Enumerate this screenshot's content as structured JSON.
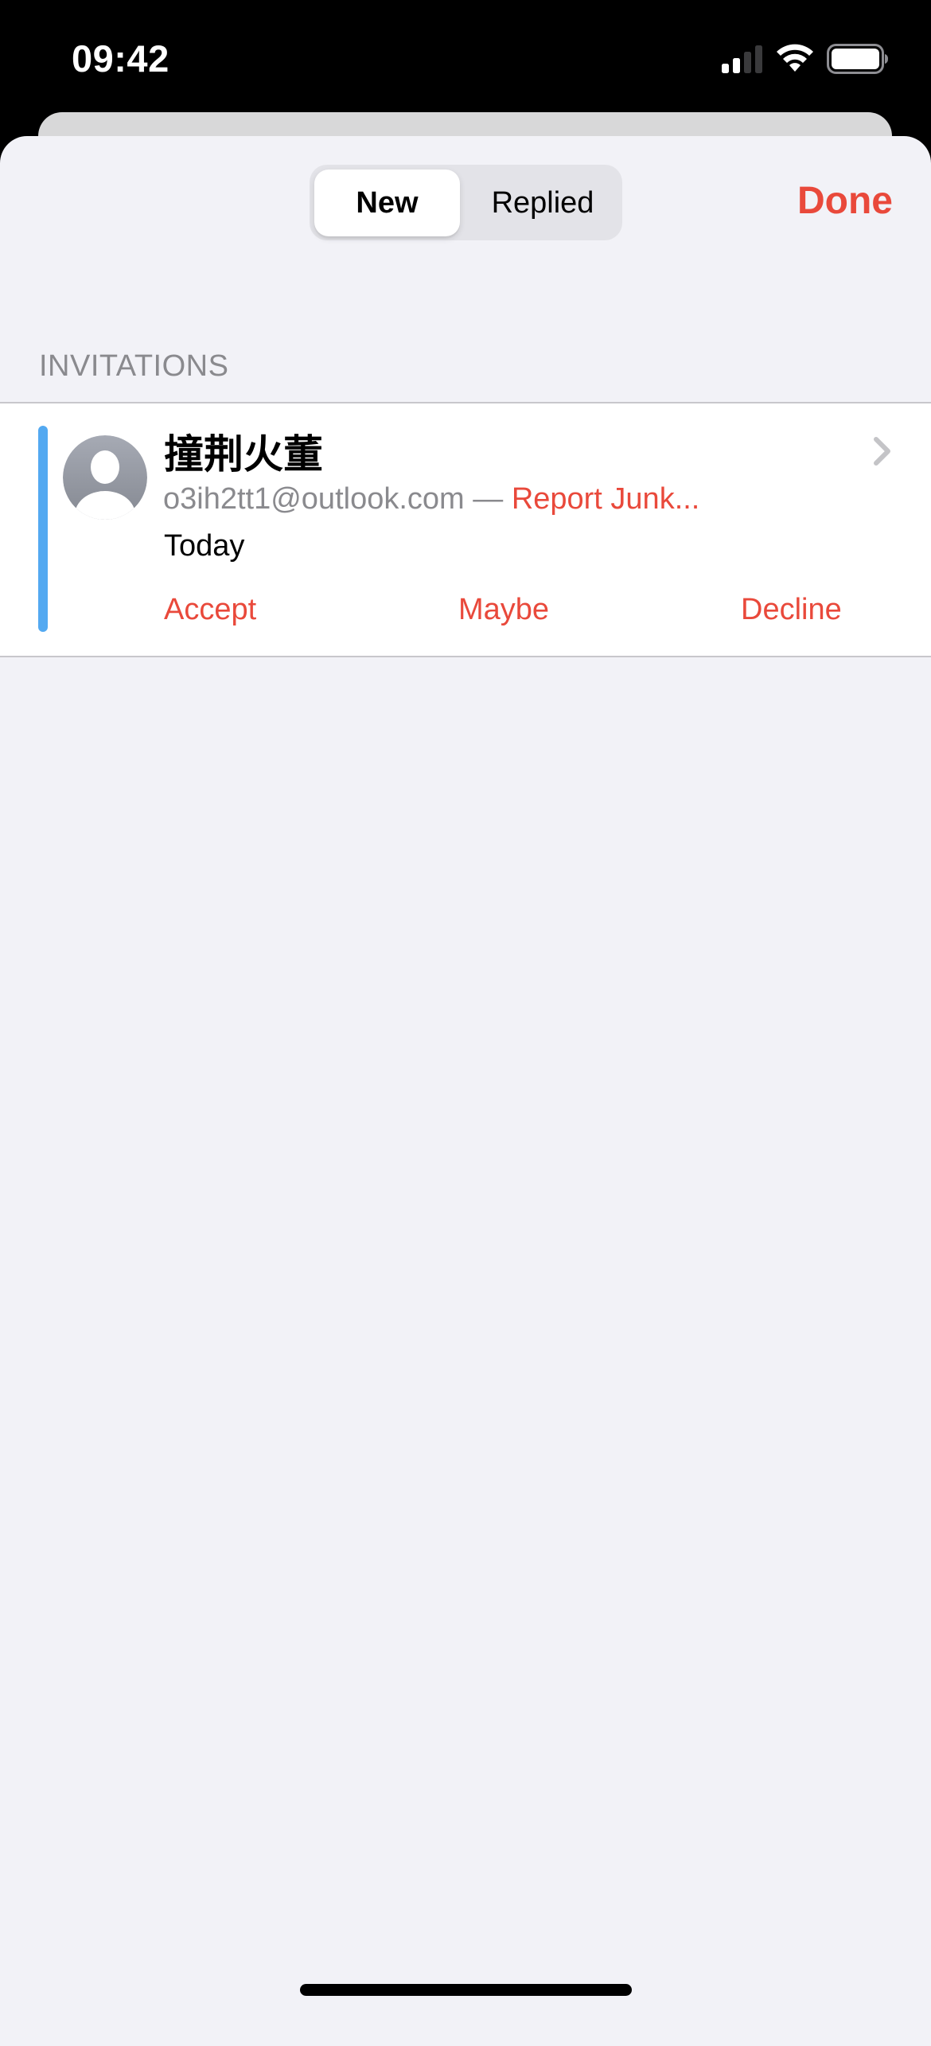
{
  "status_bar": {
    "time": "09:42",
    "signal_icon": "cellular-signal-icon",
    "signal_bars_active": 2,
    "signal_bars_total": 4,
    "wifi_icon": "wifi-icon",
    "battery_icon": "battery-icon",
    "battery_level": 1.0
  },
  "header": {
    "segments": [
      {
        "label": "New",
        "selected": true
      },
      {
        "label": "Replied",
        "selected": false
      }
    ],
    "done_label": "Done"
  },
  "section": {
    "title": "INVITATIONS"
  },
  "invitations": [
    {
      "avatar_icon": "person-silhouette-icon",
      "name": "撞荆火董",
      "email": "o3ih2tt1@outlook.com",
      "separator": "—",
      "report_junk_label": "Report Junk...",
      "date": "Today",
      "chevron_icon": "chevron-right-icon",
      "calendar_color": "#53a9f1",
      "actions": {
        "accept": "Accept",
        "maybe": "Maybe",
        "decline": "Decline"
      }
    }
  ],
  "colors": {
    "accent": "#e9493b",
    "secondary_text": "#8a8a8e",
    "background": "#f2f2f7"
  }
}
